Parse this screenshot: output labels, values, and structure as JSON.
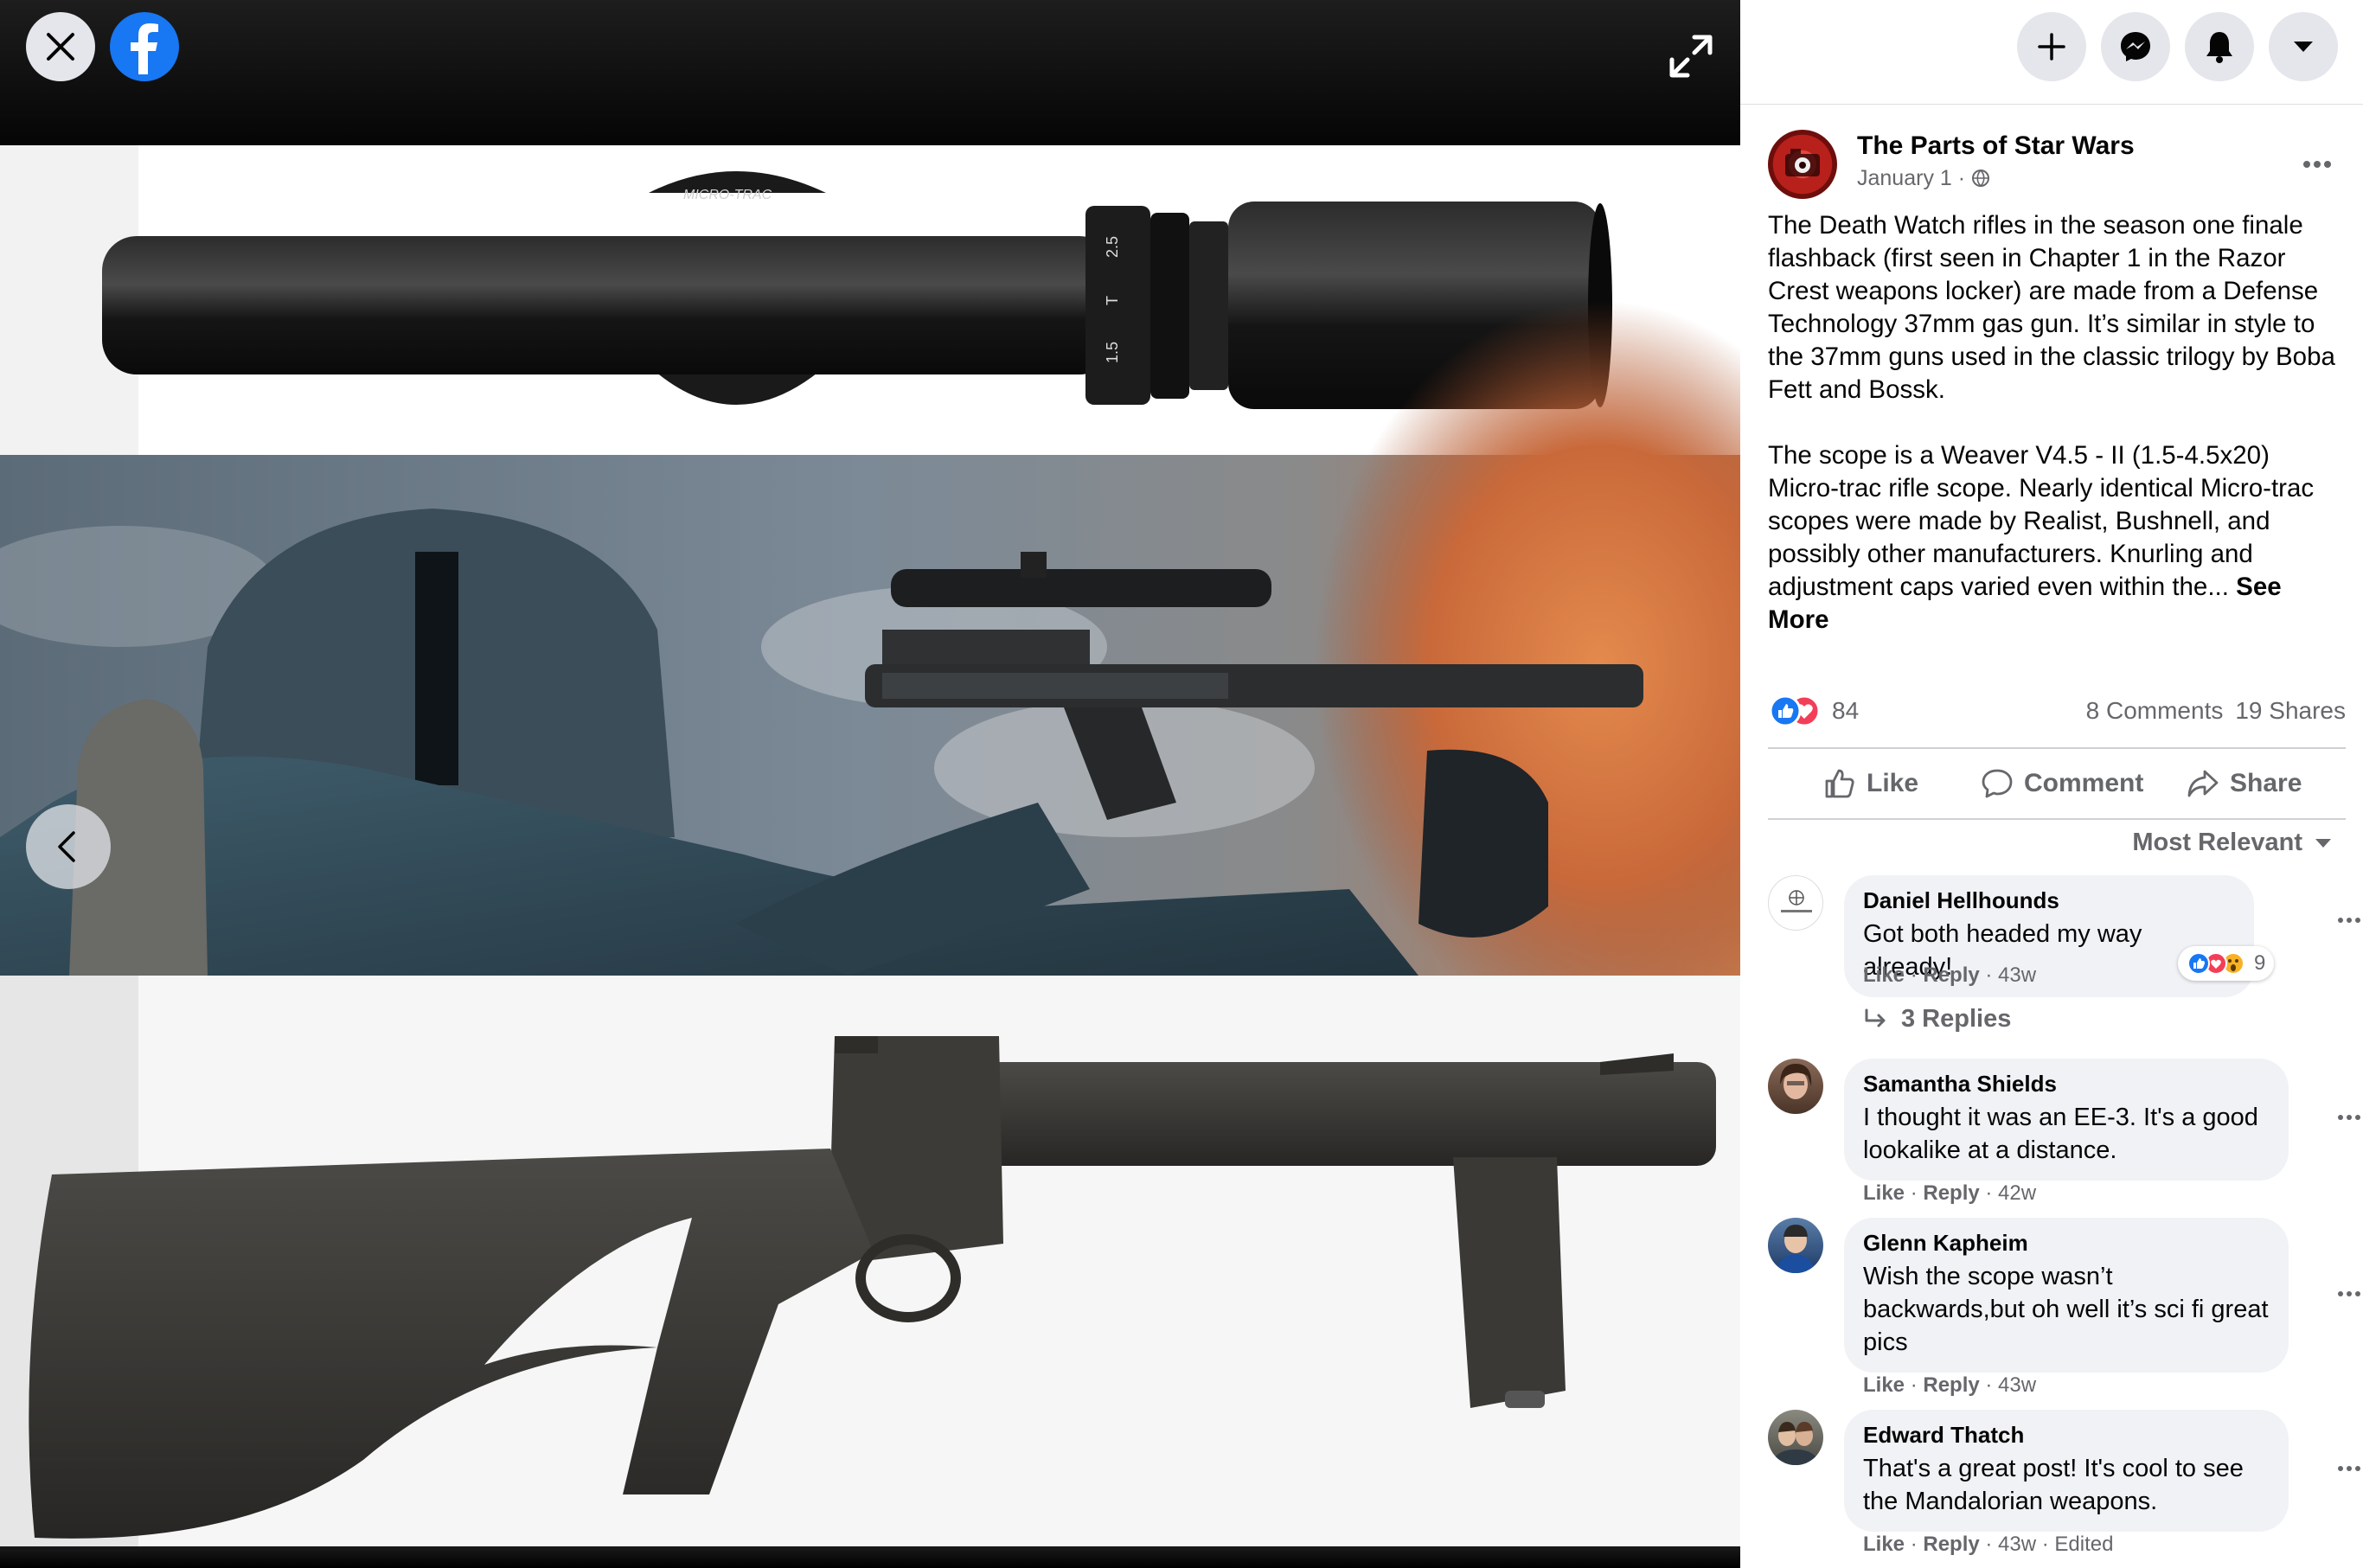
{
  "viewer": {
    "close_icon": "close-icon",
    "brand_icon": "facebook-logo-icon",
    "expand_icon": "expand-icon",
    "prev_icon": "chevron-left-icon",
    "scope_markings": {
      "brand": "MICRO-TRAC",
      "mag_low": "1.5",
      "mag_mid": "T",
      "mag_high": "2.5"
    }
  },
  "header_buttons": [
    {
      "icon": "plus-icon"
    },
    {
      "icon": "messenger-icon"
    },
    {
      "icon": "bell-icon"
    },
    {
      "icon": "caret-down-icon"
    }
  ],
  "post": {
    "page_name": "The Parts of Star Wars",
    "date": "January 1 · ",
    "privacy_icon": "globe-icon",
    "more_icon": "more-dots-icon",
    "paragraph1": "The Death Watch rifles in the season one finale flashback (first seen in Chapter 1 in the Razor Crest weapons locker) are made from a Defense Technology 37mm gas gun. It’s similar in style to the 37mm guns used in the classic trilogy by Boba Fett and Bossk.",
    "paragraph2": "The scope is a Weaver V4.5 - II (1.5-4.5x20) Micro-trac rifle scope. Nearly identical Micro-trac scopes were made by Realist, Bushnell, and possibly other manufacturers. Knurling and adjustment caps varied even within the... ",
    "see_more": "See More",
    "reaction_count": "84",
    "comments_count": "8 Comments",
    "shares_count": "19 Shares",
    "actions": {
      "like": "Like",
      "comment": "Comment",
      "share": "Share"
    },
    "sort_label": "Most Relevant"
  },
  "comments": [
    {
      "author": "Daniel Hellhounds",
      "text": "Got both headed my way already!",
      "like": "Like",
      "reply": "Reply",
      "time": "43w",
      "reactions": "9",
      "replies": "3 Replies"
    },
    {
      "author": "Samantha Shields",
      "text": "I thought it was an EE-3. It's a good lookalike at a distance.",
      "like": "Like",
      "reply": "Reply",
      "time": "42w"
    },
    {
      "author": "Glenn Kapheim",
      "text": "Wish the scope wasn’t backwards,but oh well it’s sci fi great pics",
      "like": "Like",
      "reply": "Reply",
      "time": "43w"
    },
    {
      "author": "Edward Thatch",
      "text": "That's a great post! It's cool to see the Mandalorian weapons.",
      "like": "Like",
      "reply": "Reply",
      "time": "43w",
      "edited": "Edited"
    }
  ],
  "colors": {
    "brand": "#1877f2",
    "secondary_text": "#65676b",
    "bubble": "#f0f2f5",
    "love": "#f33e58"
  }
}
